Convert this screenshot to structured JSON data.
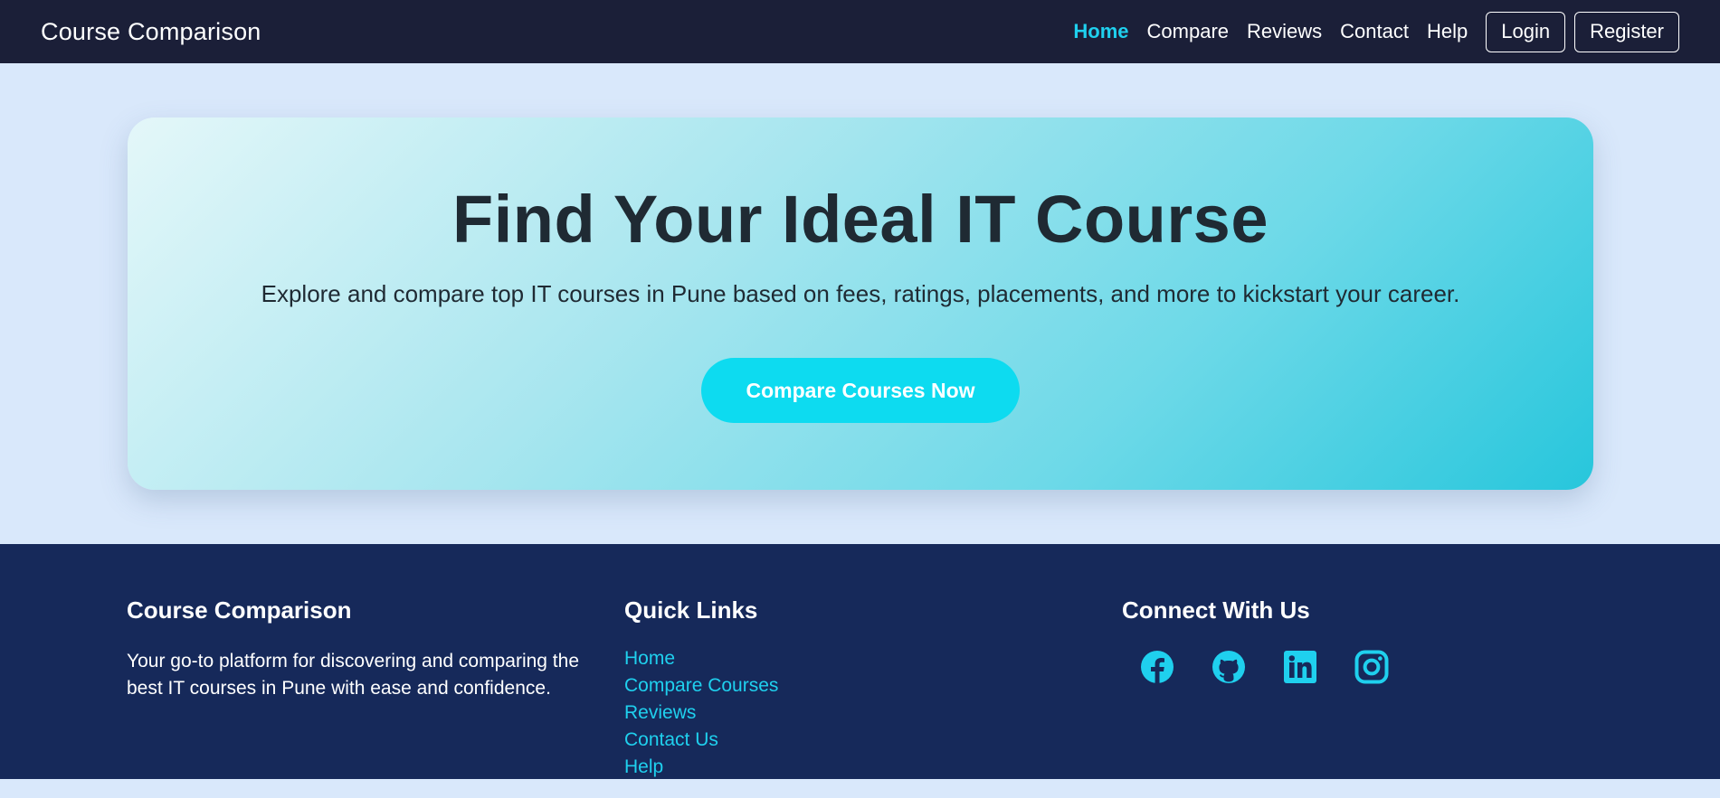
{
  "navbar": {
    "brand": "Course Comparison",
    "links": [
      "Home",
      "Compare",
      "Reviews",
      "Contact",
      "Help"
    ],
    "login_label": "Login",
    "register_label": "Register",
    "active_color": "#1fd0ee"
  },
  "hero": {
    "title": "Find Your Ideal IT Course",
    "subtitle": "Explore and compare top IT courses in Pune based on fees, ratings, placements, and more to kickstart your career.",
    "cta_label": "Compare Courses Now"
  },
  "footer": {
    "about_heading": "Course Comparison",
    "about_text": "Your go-to platform for discovering and comparing the best IT courses in Pune with ease and confidence.",
    "links_heading": "Quick Links",
    "links": [
      "Home",
      "Compare Courses",
      "Reviews",
      "Contact Us",
      "Help"
    ],
    "social_heading": "Connect With Us",
    "social_icons": [
      "facebook-icon",
      "github-icon",
      "linkedin-icon",
      "instagram-icon"
    ],
    "accent_color": "#1fd0ee"
  }
}
